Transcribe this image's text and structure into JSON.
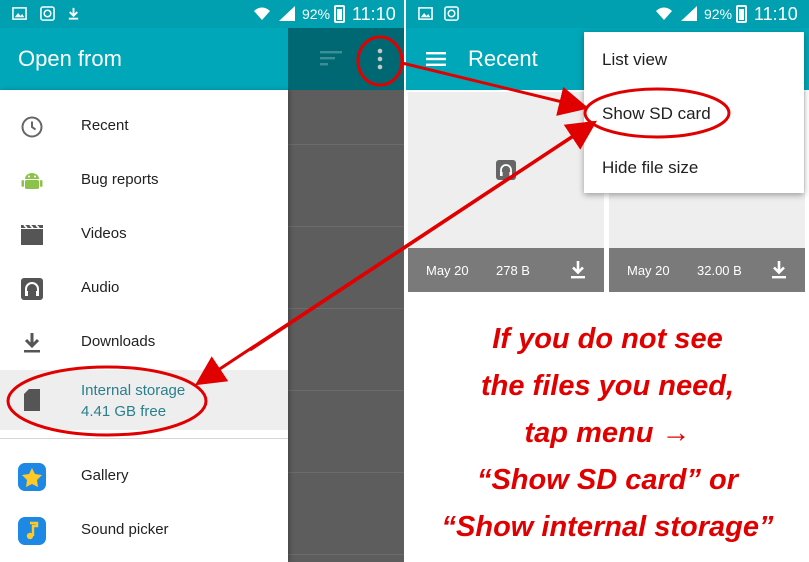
{
  "status_bar": {
    "battery_pct": "92%",
    "time": "11:10"
  },
  "left_screen": {
    "title": "Open from",
    "items": [
      {
        "label": "Recent",
        "icon": "clock-icon"
      },
      {
        "label": "Bug reports",
        "icon": "android-icon"
      },
      {
        "label": "Videos",
        "icon": "video-icon"
      },
      {
        "label": "Audio",
        "icon": "audio-icon"
      },
      {
        "label": "Downloads",
        "icon": "download-icon"
      },
      {
        "label": "Internal storage",
        "sub": "4.41 GB free",
        "icon": "sd-card-icon"
      },
      {
        "label": "Gallery",
        "icon": "gallery-icon"
      },
      {
        "label": "Sound picker",
        "icon": "music-note-icon"
      }
    ]
  },
  "right_screen": {
    "title": "Recent",
    "files": [
      {
        "date": "May 20",
        "size": "278 B"
      },
      {
        "date": "May 20",
        "size": "32.00 B"
      }
    ],
    "menu": [
      {
        "label": "List view"
      },
      {
        "label": "Show SD card"
      },
      {
        "label": "Hide file size"
      }
    ]
  },
  "caption": {
    "line1": "If you do not see",
    "line2": "the files you need,",
    "line3": "tap menu  →",
    "line4": "“Show SD card” or",
    "line5": "“Show internal storage”"
  },
  "colors": {
    "appbar": "#00a7b8",
    "statusbar": "#00a0b0",
    "annotation": "#e00000",
    "accent_text": "#2a7f8d"
  }
}
